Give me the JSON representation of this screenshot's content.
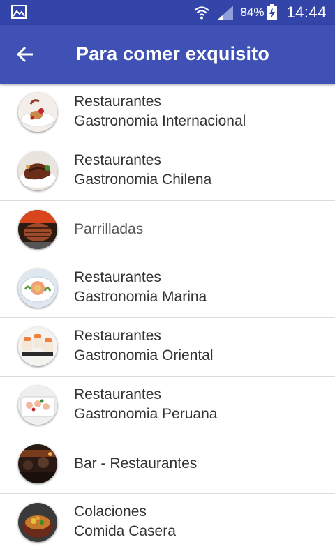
{
  "status_bar": {
    "battery_percent": "84%",
    "time": "14:44"
  },
  "app_bar": {
    "title": "Para comer exquisito"
  },
  "items": [
    {
      "line1": "Restaurantes",
      "line2": "Gastronomia Internacional",
      "image": "plated-dessert"
    },
    {
      "line1": "Restaurantes",
      "line2": "Gastronomia Chilena",
      "image": "meat-dish"
    },
    {
      "line1": "Parrilladas",
      "line2": "",
      "image": "grilled-meat"
    },
    {
      "line1": "Restaurantes",
      "line2": "Gastronomia Marina",
      "image": "seafood-plate"
    },
    {
      "line1": "Restaurantes",
      "line2": "Gastronomia Oriental",
      "image": "sushi-rolls"
    },
    {
      "line1": "Restaurantes",
      "line2": "Gastronomia Peruana",
      "image": "ceviche"
    },
    {
      "line1": "Bar - Restaurantes",
      "line2": "",
      "image": "bar-interior"
    },
    {
      "line1": "Colaciones",
      "line2": "Comida Casera",
      "image": "stew-bowl"
    }
  ]
}
